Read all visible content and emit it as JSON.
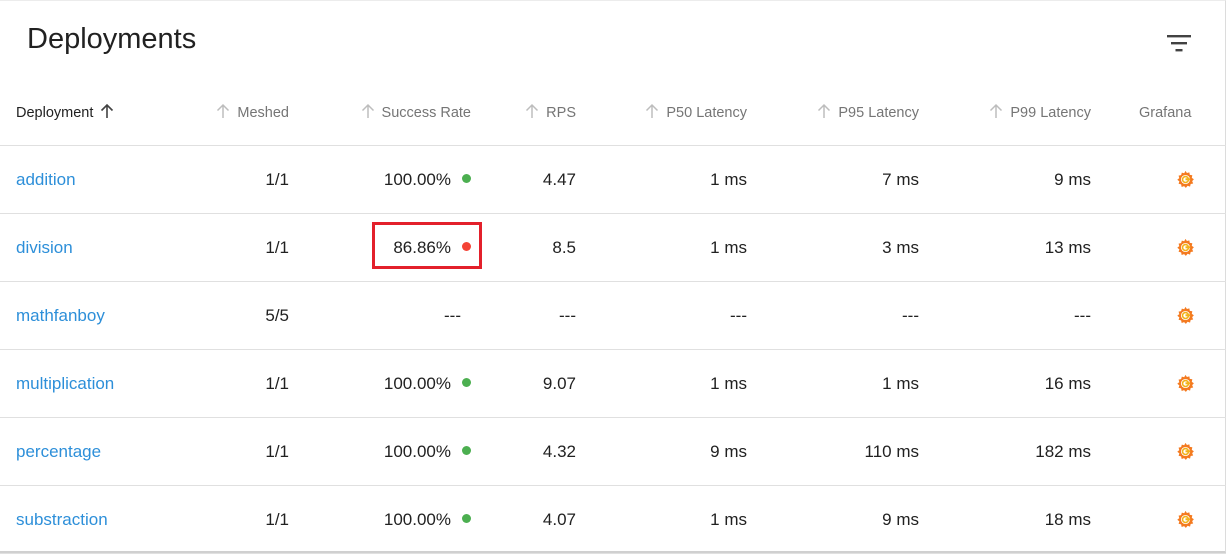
{
  "page": {
    "title": "Deployments",
    "filter_icon": "filter-list-icon"
  },
  "columns": [
    {
      "label": "Deployment",
      "sorted": true
    },
    {
      "label": "Meshed"
    },
    {
      "label": "Success Rate"
    },
    {
      "label": "RPS"
    },
    {
      "label": "P50 Latency"
    },
    {
      "label": "P95 Latency"
    },
    {
      "label": "P99 Latency"
    },
    {
      "label": "Grafana"
    }
  ],
  "rows": [
    {
      "name": "addition",
      "meshed": "1/1",
      "success_rate": "100.00%",
      "status": "ok",
      "rps": "4.47",
      "p50": "1 ms",
      "p95": "7 ms",
      "p99": "9 ms"
    },
    {
      "name": "division",
      "meshed": "1/1",
      "success_rate": "86.86%",
      "status": "bad",
      "rps": "8.5",
      "p50": "1 ms",
      "p95": "3 ms",
      "p99": "13 ms"
    },
    {
      "name": "mathfanboy",
      "meshed": "5/5",
      "success_rate": "---",
      "status": "none",
      "rps": "---",
      "p50": "---",
      "p95": "---",
      "p99": "---"
    },
    {
      "name": "multiplication",
      "meshed": "1/1",
      "success_rate": "100.00%",
      "status": "ok",
      "rps": "9.07",
      "p50": "1 ms",
      "p95": "1 ms",
      "p99": "16 ms"
    },
    {
      "name": "percentage",
      "meshed": "1/1",
      "success_rate": "100.00%",
      "status": "ok",
      "rps": "4.32",
      "p50": "9 ms",
      "p95": "110 ms",
      "p99": "182 ms"
    },
    {
      "name": "substraction",
      "meshed": "1/1",
      "success_rate": "100.00%",
      "status": "ok",
      "rps": "4.07",
      "p50": "1 ms",
      "p95": "9 ms",
      "p99": "18 ms"
    }
  ],
  "colors": {
    "link": "#2d8fd9",
    "status_ok": "#4caf50",
    "status_bad": "#f44336",
    "highlight_box": "#e3202b",
    "grafana_orange": "#f47a20"
  },
  "icons": {
    "grafana": "grafana-icon",
    "sort": "arrow-up-icon"
  }
}
